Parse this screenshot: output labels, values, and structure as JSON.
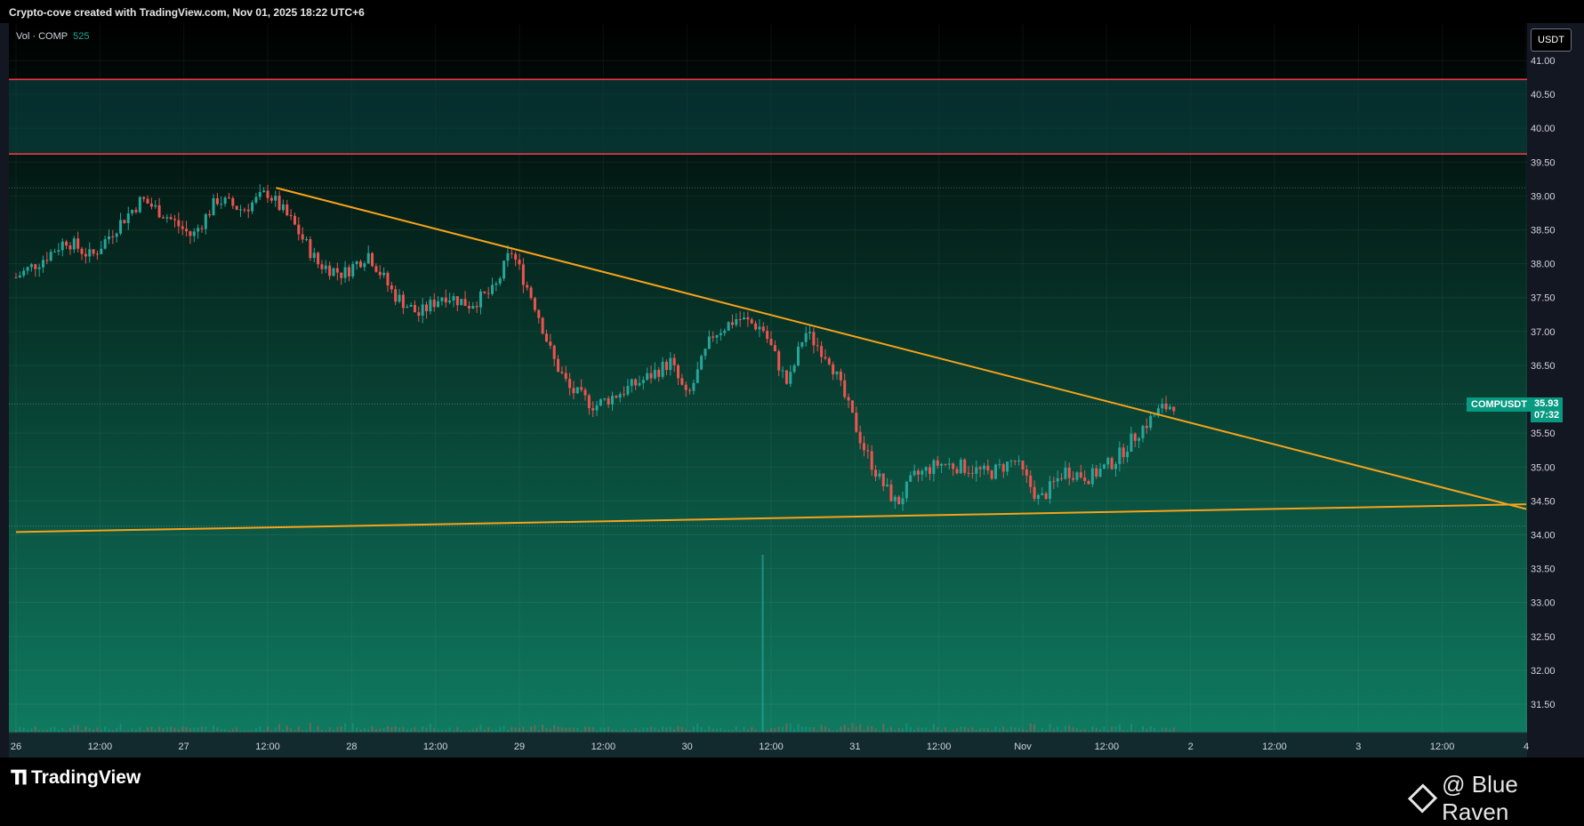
{
  "header": {
    "attribution": "Crypto-cove created with TradingView.com, Nov 01, 2025 18:22 UTC+6"
  },
  "indicator": {
    "label": "Vol · COMP",
    "value": "525"
  },
  "currency_button": "USDT",
  "last_price": {
    "symbol": "COMPUSDT",
    "price": "35.93",
    "countdown": "07:32"
  },
  "branding": {
    "logo_text": "TradingView",
    "watermark": "@ Blue Raven"
  },
  "colors": {
    "up": "#26a69a",
    "down": "#ef5350",
    "trendline": "#f7a21b",
    "zone_line": "#f23645",
    "bg_top": "#000000",
    "bg_bottom": "#0f7a60"
  },
  "chart_data": {
    "type": "candlestick",
    "symbol": "COMPUSDT",
    "y_axis": {
      "ylim": [
        31.2,
        41.25
      ],
      "ticks": [
        "41.00",
        "40.50",
        "40.00",
        "39.50",
        "39.00",
        "38.50",
        "38.00",
        "37.50",
        "37.00",
        "36.50",
        "35.50",
        "35.00",
        "34.50",
        "34.00",
        "33.50",
        "33.00",
        "32.50",
        "32.00",
        "31.50"
      ]
    },
    "x_axis": {
      "xlim": [
        26.0,
        30.0
      ],
      "ticks": [
        {
          "label": "26",
          "x": 26.0
        },
        {
          "label": "12:00",
          "x": 26.5
        },
        {
          "label": "27",
          "x": 27.0
        },
        {
          "label": "12:00",
          "x": 27.5
        },
        {
          "label": "28",
          "x": 28.0
        },
        {
          "label": "12:00",
          "x": 28.5
        },
        {
          "label": "29",
          "x": 29.0
        },
        {
          "label": "12:00",
          "x": 29.5
        },
        {
          "label": "30",
          "x": 30.0
        },
        {
          "label": "12:00",
          "x": 30.5
        },
        {
          "label": "31",
          "x": 31.0
        },
        {
          "label": "12:00",
          "x": 31.5
        },
        {
          "label": "Nov",
          "x": 32.0
        },
        {
          "label": "12:00",
          "x": 32.5
        },
        {
          "label": "2",
          "x": 33.0
        },
        {
          "label": "12:00",
          "x": 33.5
        },
        {
          "label": "3",
          "x": 34.0
        },
        {
          "label": "12:00",
          "x": 34.5
        },
        {
          "label": "4",
          "x": 35.0
        }
      ],
      "domain": [
        26.0,
        35.0
      ]
    },
    "resistance_zone": {
      "top": 40.72,
      "bottom": 39.62
    },
    "reference_lines": [
      39.12,
      34.13,
      35.93
    ],
    "trendlines": [
      {
        "name": "descending",
        "from": [
          27.55,
          39.12
        ],
        "to": [
          35.0,
          34.38
        ]
      },
      {
        "name": "ascending",
        "from": [
          26.0,
          34.04
        ],
        "to": [
          35.0,
          34.45
        ]
      }
    ],
    "price_path": [
      [
        26.0,
        37.8
      ],
      [
        26.15,
        38.05
      ],
      [
        26.3,
        38.35
      ],
      [
        26.45,
        38.1
      ],
      [
        26.6,
        38.55
      ],
      [
        26.75,
        38.95
      ],
      [
        26.9,
        38.7
      ],
      [
        27.05,
        38.4
      ],
      [
        27.2,
        38.95
      ],
      [
        27.35,
        38.8
      ],
      [
        27.5,
        39.05
      ],
      [
        27.65,
        38.6
      ],
      [
        27.8,
        38.0
      ],
      [
        27.95,
        37.85
      ],
      [
        28.1,
        38.15
      ],
      [
        28.25,
        37.55
      ],
      [
        28.4,
        37.25
      ],
      [
        28.55,
        37.55
      ],
      [
        28.7,
        37.4
      ],
      [
        28.85,
        37.6
      ],
      [
        28.95,
        38.2
      ],
      [
        29.1,
        37.35
      ],
      [
        29.2,
        36.6
      ],
      [
        29.3,
        36.15
      ],
      [
        29.45,
        35.9
      ],
      [
        29.6,
        36.1
      ],
      [
        29.75,
        36.3
      ],
      [
        29.9,
        36.55
      ],
      [
        30.0,
        36.0
      ],
      [
        30.15,
        36.95
      ],
      [
        30.3,
        37.2
      ],
      [
        30.45,
        37.05
      ],
      [
        30.6,
        36.2
      ],
      [
        30.7,
        37.0
      ],
      [
        30.85,
        36.6
      ],
      [
        30.95,
        35.95
      ],
      [
        31.05,
        35.3
      ],
      [
        31.15,
        34.8
      ],
      [
        31.25,
        34.45
      ],
      [
        31.35,
        34.85
      ],
      [
        31.5,
        35.05
      ],
      [
        31.65,
        35.0
      ],
      [
        31.8,
        34.9
      ],
      [
        31.95,
        35.1
      ],
      [
        32.1,
        34.5
      ],
      [
        32.25,
        34.95
      ],
      [
        32.4,
        34.85
      ],
      [
        32.55,
        35.1
      ],
      [
        32.7,
        35.55
      ],
      [
        32.82,
        35.85
      ],
      [
        32.9,
        35.93
      ]
    ],
    "volume_spike_x": 30.45
  }
}
